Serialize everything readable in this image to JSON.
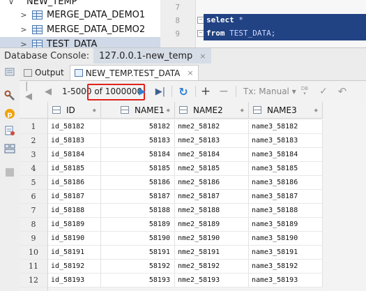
{
  "tree": {
    "items": [
      {
        "label": "NEW_TEMP",
        "arrow": "∨"
      },
      {
        "label": "MERGE_DATA_DEMO1",
        "arrow": ">"
      },
      {
        "label": "MERGE_DATA_DEMO2",
        "arrow": ">"
      },
      {
        "label": "TEST_DATA",
        "arrow": ">"
      }
    ]
  },
  "editor": {
    "line_numbers": [
      "7",
      "8",
      "9"
    ],
    "lines": [
      {
        "keyword": "select",
        "rest": " *"
      },
      {
        "keyword": "from",
        "rest": " TEST_DATA;"
      }
    ]
  },
  "console": {
    "title": "Database Console:",
    "connection_tab": "127.0.0.1-new_temp",
    "close": "×"
  },
  "tabs": {
    "output": "Output",
    "result": "NEW_TEMP.TEST_DATA",
    "close": "×"
  },
  "toolbar": {
    "first": "|◀",
    "prev": "◀",
    "range": "1-5000",
    "of_total": "of 1000000",
    "next": "▶",
    "last": "▶|",
    "refresh": "↻",
    "add": "+",
    "remove": "−",
    "tx_mode": "Tx: Manual",
    "tx_arrow": "▾",
    "db": "DB",
    "commit": "✓",
    "rollback": "↶"
  },
  "grid": {
    "columns": [
      "ID",
      "NAME1",
      "NAME2",
      "NAME3"
    ],
    "rows": [
      {
        "n": "1",
        "id": "id_58182",
        "name1": "58182",
        "name2": "nme2_58182",
        "name3": "name3_58182"
      },
      {
        "n": "2",
        "id": "id_58183",
        "name1": "58183",
        "name2": "nme2_58183",
        "name3": "name3_58183"
      },
      {
        "n": "3",
        "id": "id_58184",
        "name1": "58184",
        "name2": "nme2_58184",
        "name3": "name3_58184"
      },
      {
        "n": "4",
        "id": "id_58185",
        "name1": "58185",
        "name2": "nme2_58185",
        "name3": "name3_58185"
      },
      {
        "n": "5",
        "id": "id_58186",
        "name1": "58186",
        "name2": "nme2_58186",
        "name3": "name3_58186"
      },
      {
        "n": "6",
        "id": "id_58187",
        "name1": "58187",
        "name2": "nme2_58187",
        "name3": "name3_58187"
      },
      {
        "n": "7",
        "id": "id_58188",
        "name1": "58188",
        "name2": "nme2_58188",
        "name3": "name3_58188"
      },
      {
        "n": "8",
        "id": "id_58189",
        "name1": "58189",
        "name2": "nme2_58189",
        "name3": "name3_58189"
      },
      {
        "n": "9",
        "id": "id_58190",
        "name1": "58190",
        "name2": "nme2_58190",
        "name3": "name3_58190"
      },
      {
        "n": "10",
        "id": "id_58191",
        "name1": "58191",
        "name2": "nme2_58191",
        "name3": "name3_58191"
      },
      {
        "n": "11",
        "id": "id_58192",
        "name1": "58192",
        "name2": "nme2_58192",
        "name3": "name3_58192"
      },
      {
        "n": "12",
        "id": "id_58193",
        "name1": "58193",
        "name2": "nme2_58193",
        "name3": "name3_58193"
      }
    ]
  },
  "colors": {
    "selection": "#214283",
    "highlight_box": "#e0231c",
    "accent_blue": "#2f7fd6"
  }
}
